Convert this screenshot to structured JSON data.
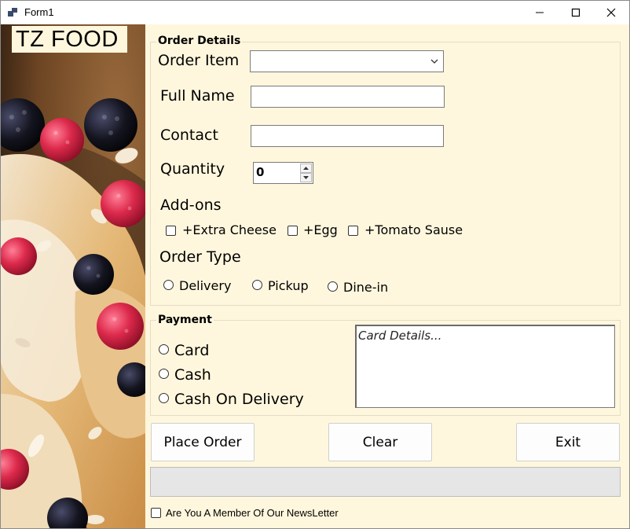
{
  "window": {
    "title": "Form1",
    "brand": "TZ FOOD"
  },
  "order_details": {
    "group_title": "Order Details",
    "order_item_label": "Order Item",
    "order_item_value": "",
    "full_name_label": "Full Name",
    "full_name_value": "",
    "contact_label": "Contact",
    "contact_value": "",
    "quantity_label": "Quantity",
    "quantity_value": "0",
    "addons_label": "Add-ons",
    "addons": [
      {
        "label": "+Extra Cheese",
        "checked": false
      },
      {
        "label": "+Egg",
        "checked": false
      },
      {
        "label": "+Tomato Sause",
        "checked": false
      }
    ],
    "order_type_label": "Order Type",
    "order_types": [
      {
        "label": "Delivery",
        "selected": false
      },
      {
        "label": "Pickup",
        "selected": false
      },
      {
        "label": "Dine-in",
        "selected": false
      }
    ]
  },
  "payment": {
    "group_title": "Payment",
    "options": [
      {
        "label": "Card",
        "selected": false
      },
      {
        "label": "Cash",
        "selected": false
      },
      {
        "label": "Cash On Delivery",
        "selected": false
      }
    ],
    "card_details_placeholder": "Card Details..."
  },
  "actions": {
    "place_order": "Place Order",
    "clear": "Clear",
    "exit": "Exit"
  },
  "progress": {
    "value": 0
  },
  "newsletter": {
    "label": "Are You A Member Of Our NewsLetter",
    "checked": false
  },
  "colors": {
    "panel_background": "#fff7dd",
    "progress_fill": "#06b025"
  },
  "icons": [
    "app-icon",
    "minimize-icon",
    "maximize-icon",
    "close-icon",
    "chevron-down-icon",
    "spin-up-icon",
    "spin-down-icon"
  ]
}
